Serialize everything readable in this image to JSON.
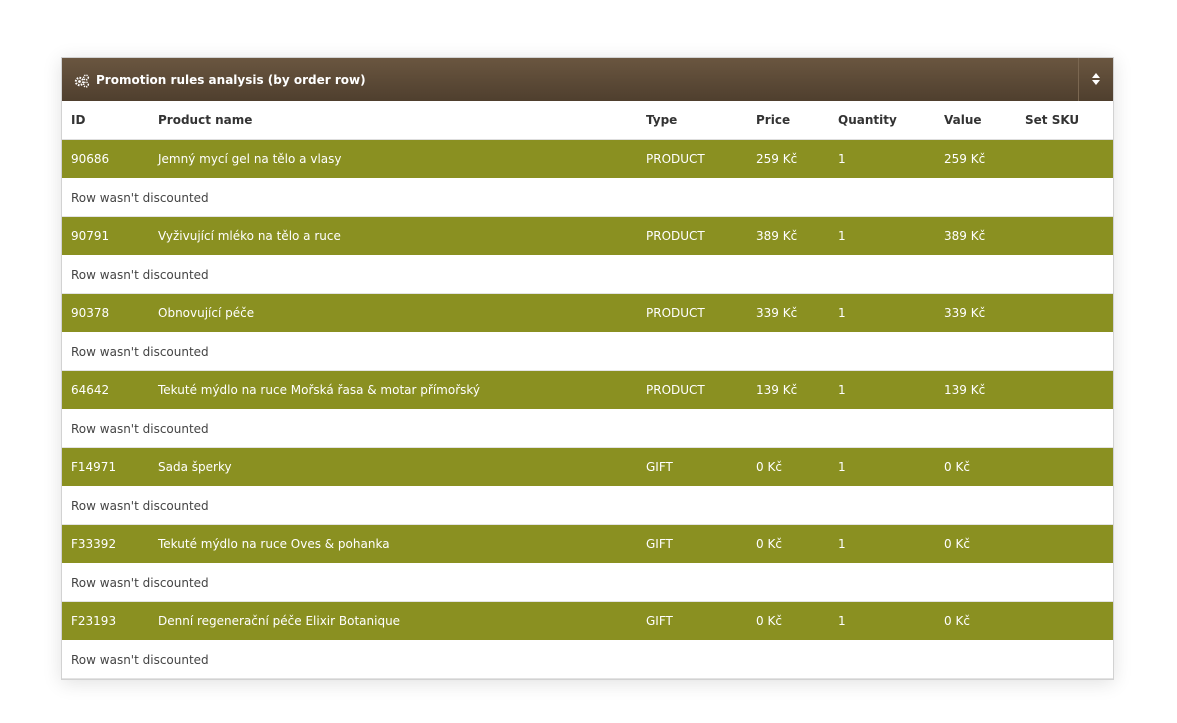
{
  "panel": {
    "title": "Promotion rules analysis (by order row)",
    "header_color": "#5a4836",
    "row_color": "#8a9021"
  },
  "columns": [
    "ID",
    "Product name",
    "Type",
    "Price",
    "Quantity",
    "Value",
    "Set SKU"
  ],
  "rows": [
    {
      "id": "90686",
      "name": "Jemný mycí gel na tělo a vlasy",
      "type": "PRODUCT",
      "price": "259 Kč",
      "quantity": "1",
      "value": "259 Kč",
      "set_sku": "",
      "note": "Row wasn't discounted"
    },
    {
      "id": "90791",
      "name": "Vyživující mléko na tělo a ruce",
      "type": "PRODUCT",
      "price": "389 Kč",
      "quantity": "1",
      "value": "389 Kč",
      "set_sku": "",
      "note": "Row wasn't discounted"
    },
    {
      "id": "90378",
      "name": "Obnovující péče",
      "type": "PRODUCT",
      "price": "339 Kč",
      "quantity": "1",
      "value": "339 Kč",
      "set_sku": "",
      "note": "Row wasn't discounted"
    },
    {
      "id": "64642",
      "name": "Tekuté mýdlo na ruce Mořská řasa & motar přímořský",
      "type": "PRODUCT",
      "price": "139 Kč",
      "quantity": "1",
      "value": "139 Kč",
      "set_sku": "",
      "note": "Row wasn't discounted"
    },
    {
      "id": "F14971",
      "name": "Sada šperky",
      "type": "GIFT",
      "price": "0 Kč",
      "quantity": "1",
      "value": "0 Kč",
      "set_sku": "",
      "note": "Row wasn't discounted"
    },
    {
      "id": "F33392",
      "name": "Tekuté mýdlo na ruce Oves & pohanka",
      "type": "GIFT",
      "price": "0 Kč",
      "quantity": "1",
      "value": "0 Kč",
      "set_sku": "",
      "note": "Row wasn't discounted"
    },
    {
      "id": "F23193",
      "name": "Denní regenerační péče Elixir Botanique",
      "type": "GIFT",
      "price": "0 Kč",
      "quantity": "1",
      "value": "0 Kč",
      "set_sku": "",
      "note": "Row wasn't discounted"
    }
  ]
}
